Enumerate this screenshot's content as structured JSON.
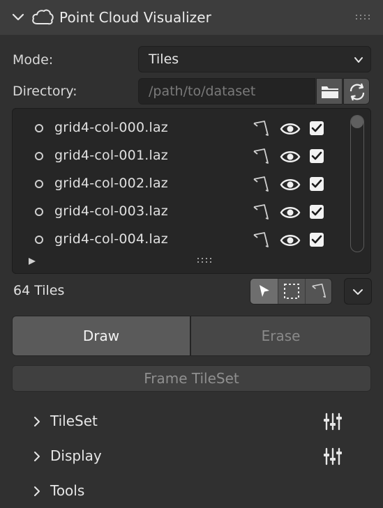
{
  "panel": {
    "title": "Point Cloud Visualizer",
    "title_icon": "cloud-icon"
  },
  "mode": {
    "label": "Mode:",
    "value": "Tiles"
  },
  "directory": {
    "label": "Directory:",
    "placeholder": "/path/to/dataset"
  },
  "files": [
    {
      "name": "grid4-col-000.laz",
      "visible": true,
      "checked": true
    },
    {
      "name": "grid4-col-001.laz",
      "visible": true,
      "checked": true
    },
    {
      "name": "grid4-col-002.laz",
      "visible": true,
      "checked": true
    },
    {
      "name": "grid4-col-003.laz",
      "visible": true,
      "checked": true
    },
    {
      "name": "grid4-col-004.laz",
      "visible": true,
      "checked": true
    }
  ],
  "tile_count": "64 Tiles",
  "selection_tools": {
    "active": "pointer",
    "items": [
      "pointer-icon",
      "box-select-icon",
      "lasso-icon"
    ]
  },
  "paint": {
    "draw_label": "Draw",
    "erase_label": "Erase",
    "active": "Draw"
  },
  "frame_button": "Frame TileSet",
  "subpanels": [
    {
      "label": "TileSet",
      "has_settings": true
    },
    {
      "label": "Display",
      "has_settings": true
    },
    {
      "label": "Tools",
      "has_settings": false
    }
  ],
  "colors": {
    "background": "#303030",
    "header": "#3d3d3d",
    "active_segment": "#5a5a5a"
  }
}
